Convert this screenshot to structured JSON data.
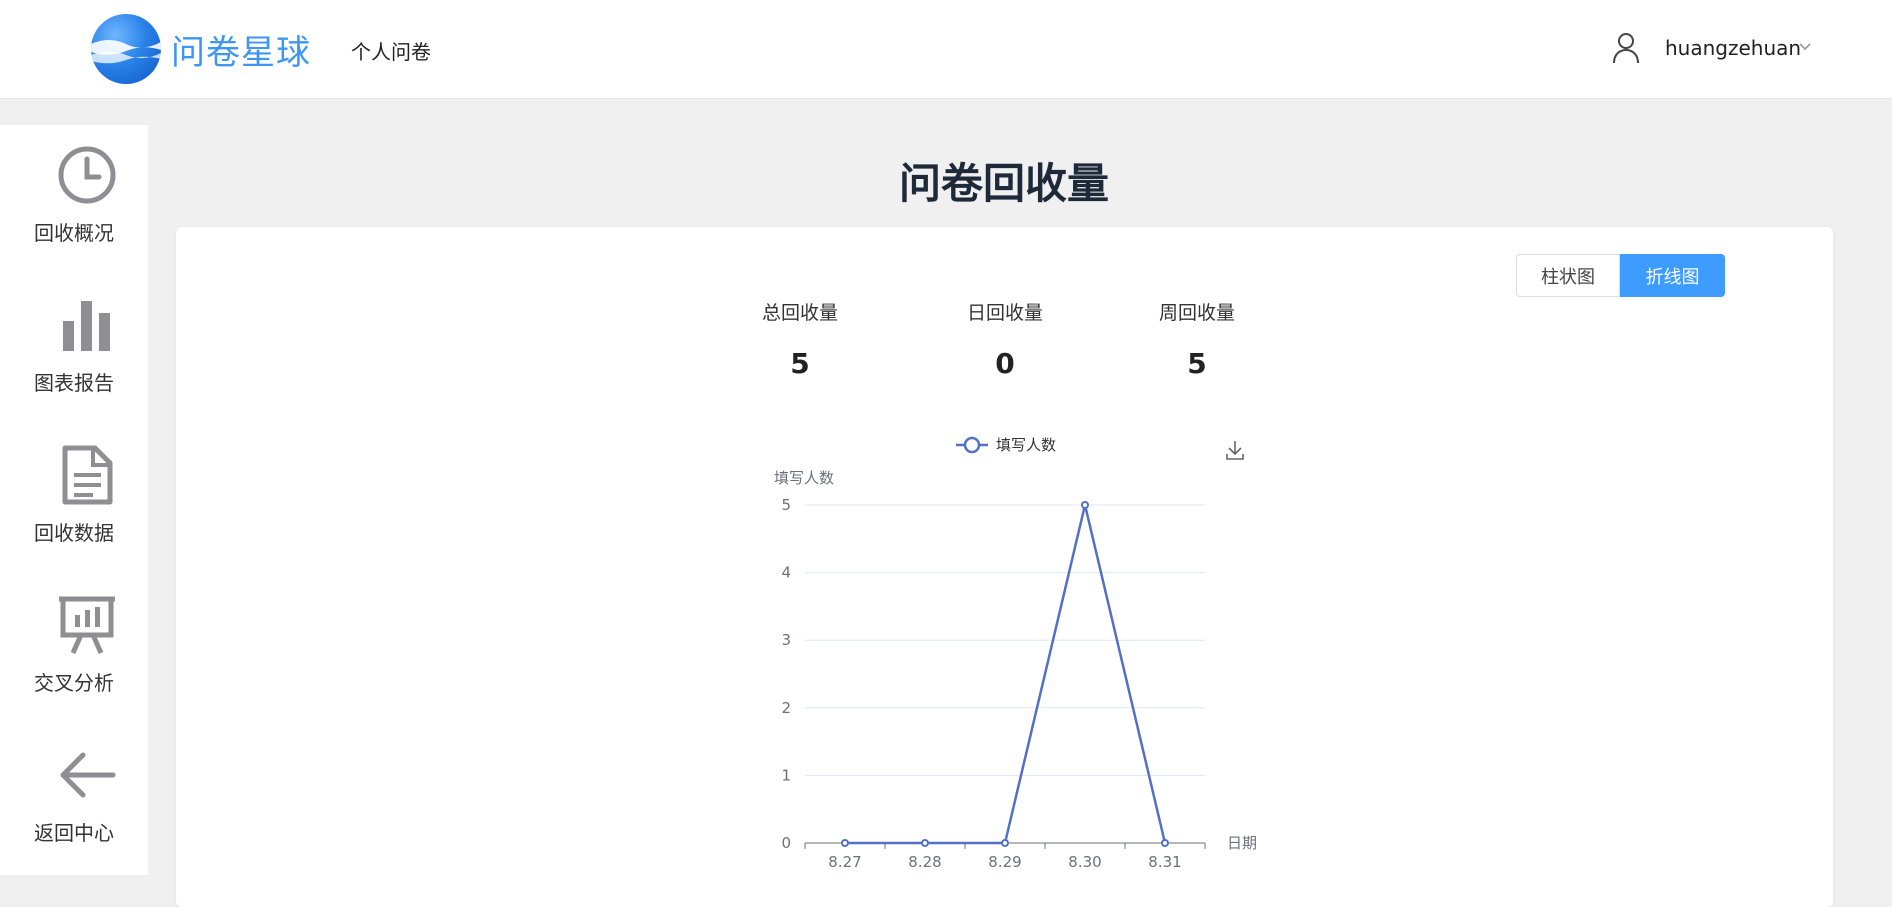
{
  "header": {
    "brand": "问卷星球",
    "nav_personal": "个人问卷",
    "username": "huangzehuan",
    "logo_icon": "planet-logo-icon",
    "user_icon": "user-icon",
    "caret_icon": "chevron-down-icon"
  },
  "sidebar": {
    "items": [
      {
        "label": "回收概况",
        "icon": "clock-icon"
      },
      {
        "label": "图表报告",
        "icon": "bar-chart-icon"
      },
      {
        "label": "回收数据",
        "icon": "document-icon"
      },
      {
        "label": "交叉分析",
        "icon": "presentation-board-icon"
      },
      {
        "label": "返回中心",
        "icon": "arrow-left-icon"
      }
    ]
  },
  "main": {
    "title": "问卷回收量",
    "toggle": {
      "bar_label": "柱状图",
      "line_label": "折线图",
      "active": "折线图"
    },
    "stats": [
      {
        "label": "总回收量",
        "value": "5"
      },
      {
        "label": "日回收量",
        "value": "0"
      },
      {
        "label": "周回收量",
        "value": "5"
      }
    ],
    "download_icon": "download-icon"
  },
  "colors": {
    "brand": "#3d96f2",
    "accent": "#3f9cff",
    "series": "#5470c6"
  },
  "chart_data": {
    "type": "line",
    "legend": "填写人数",
    "legend_position": "top-center",
    "ylabel": "填写人数",
    "xlabel": "日期",
    "categories": [
      "8.27",
      "8.28",
      "8.29",
      "8.30",
      "8.31"
    ],
    "series": [
      {
        "name": "填写人数",
        "values": [
          0,
          0,
          0,
          5,
          0
        ]
      }
    ],
    "ylim": [
      0,
      5
    ],
    "yticks": [
      "0",
      "1",
      "2",
      "3",
      "4",
      "5"
    ],
    "grid": true
  }
}
